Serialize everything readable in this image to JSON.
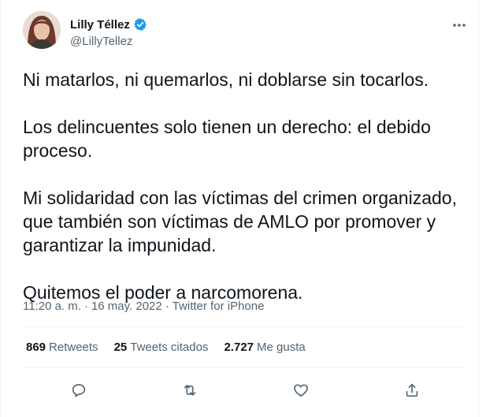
{
  "author": {
    "name": "Lilly Téllez",
    "handle": "@LillyTellez",
    "verified": true
  },
  "tweet": {
    "paragraphs": [
      "Ni matarlos, ni quemarlos, ni doblarse sin tocarlos.",
      "Los delincuentes solo tienen un derecho: el debido proceso.",
      "Mi solidaridad con las víctimas del crimen organizado, que también son víctimas de AMLO por promover y garantizar la impunidad.",
      "Quitemos el poder a narcomorena."
    ],
    "time": "11:20 a. m.",
    "separator": "·",
    "date": "16 may. 2022",
    "source": "Twitter for iPhone"
  },
  "stats": {
    "retweets_count": "869",
    "retweets_label": "Retweets",
    "quotes_count": "25",
    "quotes_label": "Tweets citados",
    "likes_count": "2.727",
    "likes_label": "Me gusta"
  },
  "icons": {
    "verified": "verified-badge-icon",
    "more": "more-options-icon",
    "reply": "reply-icon",
    "retweet": "retweet-icon",
    "like": "like-icon",
    "share": "share-icon"
  },
  "colors": {
    "text": "#0f1419",
    "secondary": "#536471",
    "verified": "#1d9bf0",
    "divider": "#eff3f4"
  }
}
